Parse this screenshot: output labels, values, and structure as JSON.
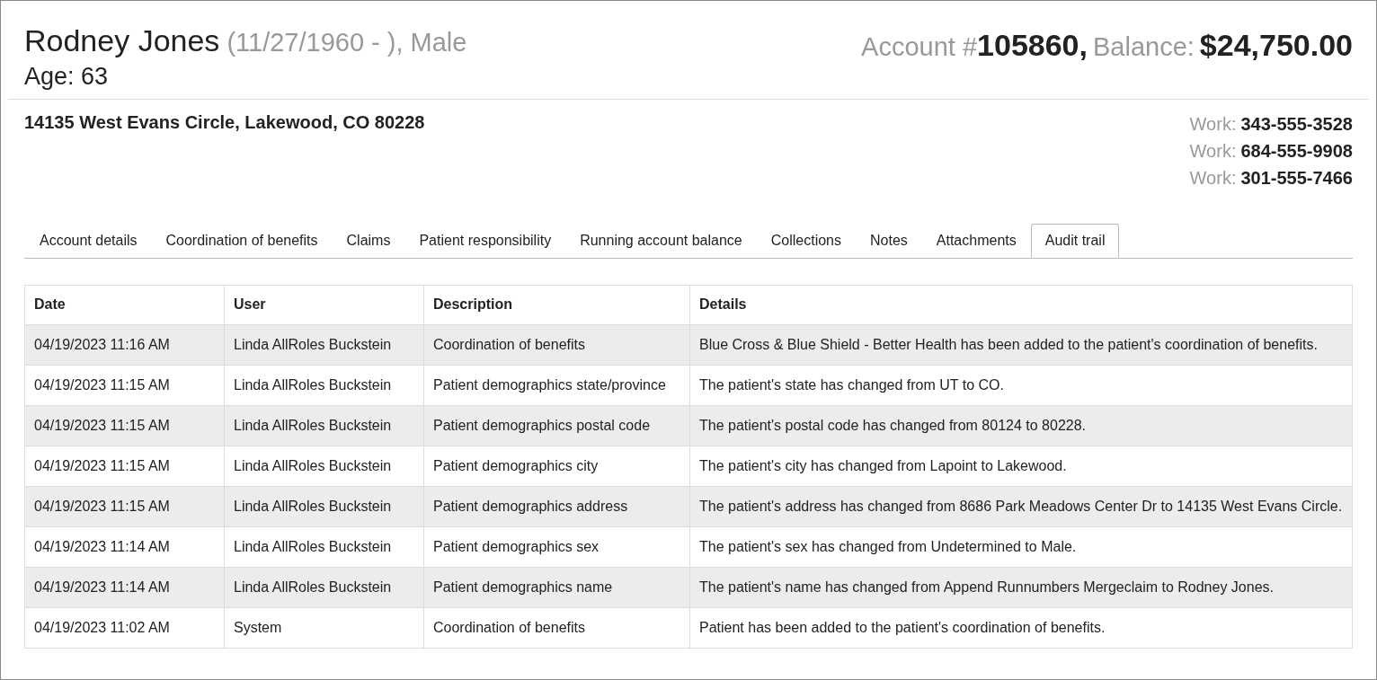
{
  "patient": {
    "name": "Rodney Jones",
    "dob_sex": "(11/27/1960 - ), Male",
    "age": "Age: 63"
  },
  "account": {
    "label": "Account #",
    "number": "105860,",
    "balance_label": "Balance:",
    "balance": "$24,750.00"
  },
  "address": "14135 West Evans Circle, Lakewood, CO 80228",
  "phones": [
    {
      "label": "Work:",
      "number": "343-555-3528"
    },
    {
      "label": "Work:",
      "number": "684-555-9908"
    },
    {
      "label": "Work:",
      "number": "301-555-7466"
    }
  ],
  "tabs": [
    {
      "label": "Account details",
      "selected": false
    },
    {
      "label": "Coordination of benefits",
      "selected": false
    },
    {
      "label": "Claims",
      "selected": false
    },
    {
      "label": "Patient responsibility",
      "selected": false
    },
    {
      "label": "Running account balance",
      "selected": false
    },
    {
      "label": "Collections",
      "selected": false
    },
    {
      "label": "Notes",
      "selected": false
    },
    {
      "label": "Attachments",
      "selected": false
    },
    {
      "label": "Audit trail",
      "selected": true
    }
  ],
  "table": {
    "columns": [
      "Date",
      "User",
      "Description",
      "Details"
    ],
    "rows": [
      [
        "04/19/2023 11:16 AM",
        "Linda AllRoles Buckstein",
        "Coordination of benefits",
        "Blue Cross & Blue Shield - Better Health has been added to the patient's coordination of benefits."
      ],
      [
        "04/19/2023 11:15 AM",
        "Linda AllRoles Buckstein",
        "Patient demographics state/province",
        "The patient's state has changed from UT to CO."
      ],
      [
        "04/19/2023 11:15 AM",
        "Linda AllRoles Buckstein",
        "Patient demographics postal code",
        "The patient's postal code has changed from 80124 to 80228."
      ],
      [
        "04/19/2023 11:15 AM",
        "Linda AllRoles Buckstein",
        "Patient demographics city",
        "The patient's city has changed from Lapoint to Lakewood."
      ],
      [
        "04/19/2023 11:15 AM",
        "Linda AllRoles Buckstein",
        "Patient demographics address",
        "The patient's address has changed from 8686 Park Meadows Center Dr to 14135 West Evans Circle."
      ],
      [
        "04/19/2023 11:14 AM",
        "Linda AllRoles Buckstein",
        "Patient demographics sex",
        "The patient's sex has changed from Undetermined to Male."
      ],
      [
        "04/19/2023 11:14 AM",
        "Linda AllRoles Buckstein",
        "Patient demographics name",
        "The patient's name has changed from Append Runnumbers Mergeclaim to Rodney Jones."
      ],
      [
        "04/19/2023 11:02 AM",
        "System",
        "Coordination of benefits",
        "Patient has been added to the patient's coordination of benefits."
      ]
    ]
  }
}
